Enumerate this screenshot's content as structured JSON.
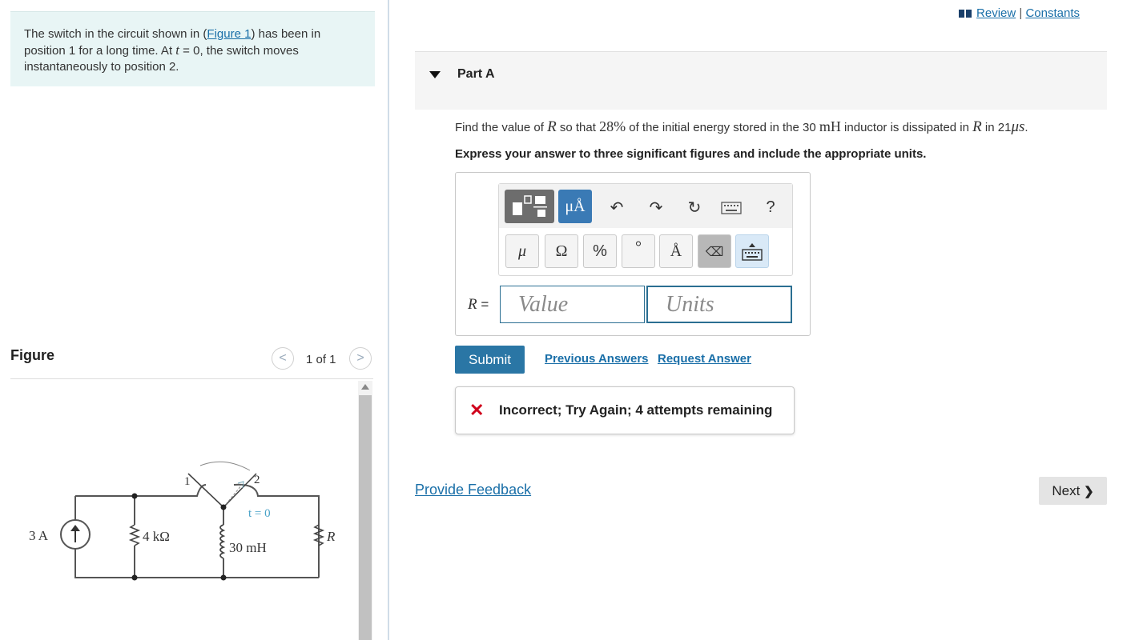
{
  "problem": {
    "text_before": "The switch in the circuit shown in (",
    "figure_link": "Figure 1",
    "text_mid": ") has been in position 1 for a long time. At ",
    "t_var": "t",
    "text_after": " = 0, the switch moves instantaneously to position 2."
  },
  "figure": {
    "title": "Figure",
    "counter": "1 of 1",
    "prev_symbol": "<",
    "next_symbol": ">",
    "circuit": {
      "source": "3 A",
      "resistor1": "4 kΩ",
      "inductor": "30 mH",
      "resistor2": "R",
      "switch_pos1": "1",
      "switch_pos2": "2",
      "switch_time": "t = 0"
    }
  },
  "top_links": {
    "review": "Review",
    "separator": "|",
    "constants": "Constants"
  },
  "part": {
    "title": "Part A"
  },
  "question": {
    "t1": "Find the value of ",
    "R": "R",
    "t2": " so that ",
    "pct_num": "28",
    "pct_sym": "%",
    "t3": " of the initial energy stored in the 30 ",
    "mH": "mH",
    "t4": " inductor is dissipated in ",
    "R2": "R",
    "t5": " in 21",
    "mu": "μs",
    "t6": ".",
    "instruction": "Express your answer to three significant figures and include the appropriate units."
  },
  "toolbar": {
    "row1": {
      "units_btn": "μÅ",
      "undo": "↶",
      "redo": "↷",
      "reset": "↻",
      "help": "?"
    },
    "row2": {
      "mu": "μ",
      "omega": "Ω",
      "percent": "%",
      "degree": "°",
      "angstrom": "Å",
      "delete": "⌫"
    }
  },
  "answer": {
    "label_var": "R",
    "label_eq": " =",
    "value_placeholder": "Value",
    "units_placeholder": "Units"
  },
  "actions": {
    "submit": "Submit",
    "previous_answers": "Previous Answers",
    "request_answer": "Request Answer"
  },
  "status": {
    "icon": "✕",
    "text": "Incorrect; Try Again; 4 attempts remaining"
  },
  "footer": {
    "provide_feedback": "Provide Feedback",
    "next": "Next",
    "next_symbol": "❯"
  }
}
